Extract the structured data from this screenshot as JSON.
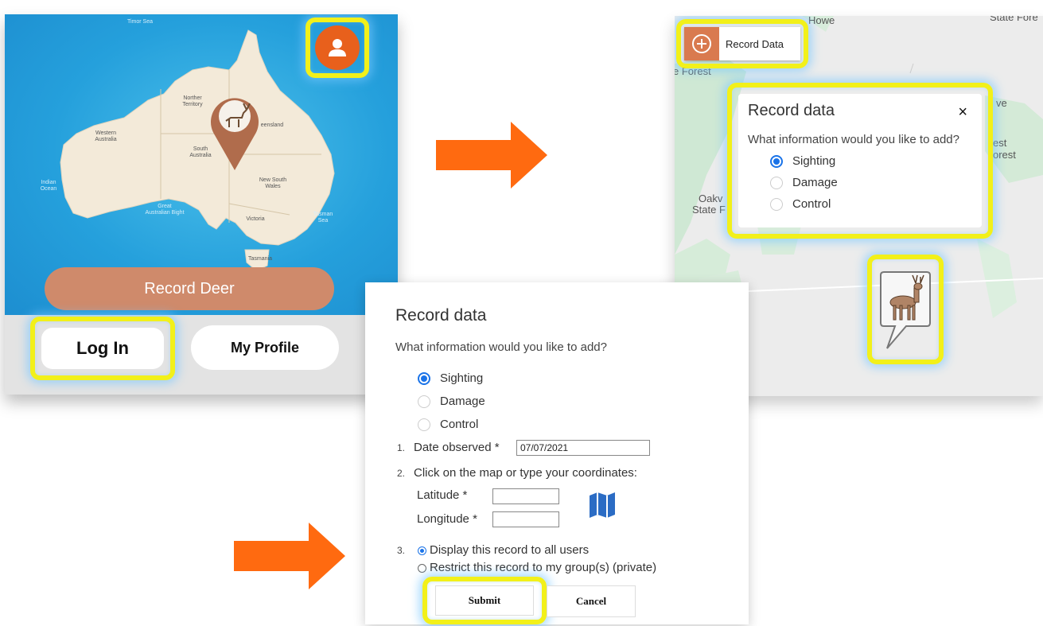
{
  "colors": {
    "accent_orange": "#e8601c",
    "record_deer": "#cf8a6b",
    "highlight": "#f2f01a",
    "radio_blue": "#1a73e8",
    "ocean": "#25a0dc",
    "land": "#f3ead9"
  },
  "panel1": {
    "profile_icon": "person-icon",
    "map_labels": {
      "timor_sea": "Timor Sea",
      "northern_territory": "Norther Territory",
      "western_australia": "Western Australia",
      "queensland": "eensland",
      "south_australia": "South Australia",
      "new_south_wales": "New South Wales",
      "indian_ocean": "Indian Ocean",
      "great_australian_bight": "Great Australian Bight",
      "victoria": "Victoria",
      "tasman_sea": "Tasman Sea",
      "tasmania": "Tasmania"
    },
    "record_deer_label": "Record Deer",
    "login_label": "Log In",
    "my_profile_label": "My Profile"
  },
  "panel2": {
    "map_labels": {
      "howe": "Howe",
      "state_forest_top": "State Fore",
      "forest_left": "e Forest",
      "oakv": "Oakv",
      "state_f": "State F",
      "est": "est",
      "forest_right": "orest",
      "ve": "ve"
    },
    "record_data_button": "Record Data",
    "popup": {
      "title": "Record data",
      "close": "×",
      "question": "What information would you like to add?",
      "options": [
        {
          "label": "Sighting",
          "checked": true
        },
        {
          "label": "Damage",
          "checked": false
        },
        {
          "label": "Control",
          "checked": false
        }
      ]
    }
  },
  "panel3": {
    "title": "Record data",
    "question": "What information would you like to add?",
    "options": [
      {
        "label": "Sighting",
        "checked": true
      },
      {
        "label": "Damage",
        "checked": false
      },
      {
        "label": "Control",
        "checked": false
      }
    ],
    "step1": {
      "num": "1.",
      "label": "Date observed *",
      "date_value": "07/07/2021"
    },
    "step2": {
      "num": "2.",
      "label": "Click on the map or type your coordinates:",
      "latitude_label": "Latitude *",
      "latitude_value": "",
      "longitude_label": "Longitude *",
      "longitude_value": "",
      "map_icon": "map-icon"
    },
    "step3": {
      "num": "3.",
      "display_all": "Display this record to all users",
      "restrict": "Restrict this record to my group(s) (private)",
      "selected": "display_all"
    },
    "submit_label": "Submit",
    "cancel_label": "Cancel"
  }
}
